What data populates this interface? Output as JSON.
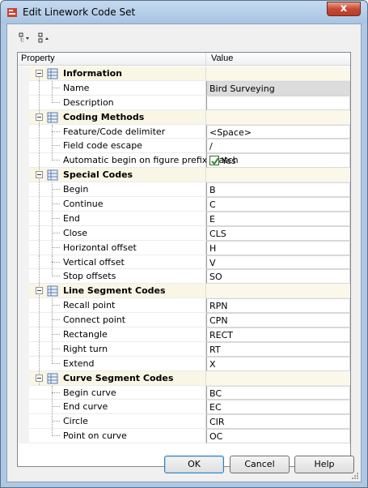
{
  "window": {
    "title": "Edit Linework Code Set",
    "close_glyph": "x"
  },
  "toolbar": {
    "buttons": [
      {
        "icon": "expand-tree-icon"
      },
      {
        "icon": "collapse-tree-icon"
      }
    ]
  },
  "grid": {
    "headers": {
      "property": "Property",
      "value": "Value"
    },
    "sections": [
      {
        "label": "Information",
        "items": [
          {
            "label": "Name",
            "value": "Bird Surveying"
          },
          {
            "label": "Description",
            "value": ""
          }
        ]
      },
      {
        "label": "Coding Methods",
        "items": [
          {
            "label": "Feature/Code delimiter",
            "value": "<Space>"
          },
          {
            "label": "Field code escape",
            "value": "/"
          },
          {
            "label": "Automatic begin on figure prefix match",
            "value": "Yes",
            "checked": true
          }
        ]
      },
      {
        "label": "Special Codes",
        "items": [
          {
            "label": "Begin",
            "value": "B"
          },
          {
            "label": "Continue",
            "value": "C"
          },
          {
            "label": "End",
            "value": "E"
          },
          {
            "label": "Close",
            "value": "CLS"
          },
          {
            "label": "Horizontal offset",
            "value": "H"
          },
          {
            "label": "Vertical offset",
            "value": "V"
          },
          {
            "label": "Stop offsets",
            "value": "SO"
          }
        ]
      },
      {
        "label": "Line Segment Codes",
        "items": [
          {
            "label": "Recall point",
            "value": "RPN"
          },
          {
            "label": "Connect point",
            "value": "CPN"
          },
          {
            "label": "Rectangle",
            "value": "RECT"
          },
          {
            "label": "Right turn",
            "value": "RT"
          },
          {
            "label": "Extend",
            "value": "X"
          }
        ]
      },
      {
        "label": "Curve Segment Codes",
        "items": [
          {
            "label": "Begin curve",
            "value": "BC"
          },
          {
            "label": "End curve",
            "value": "EC"
          },
          {
            "label": "Circle",
            "value": "CIR"
          },
          {
            "label": "Point on curve",
            "value": "OC"
          }
        ]
      }
    ]
  },
  "buttons": {
    "ok": "OK",
    "cancel": "Cancel",
    "help": "Help"
  },
  "colors": {
    "frame": "#aec7e2",
    "close_button": "#c74a33",
    "category_row": "#faf6e6",
    "check_green": "#2f8a2f"
  }
}
